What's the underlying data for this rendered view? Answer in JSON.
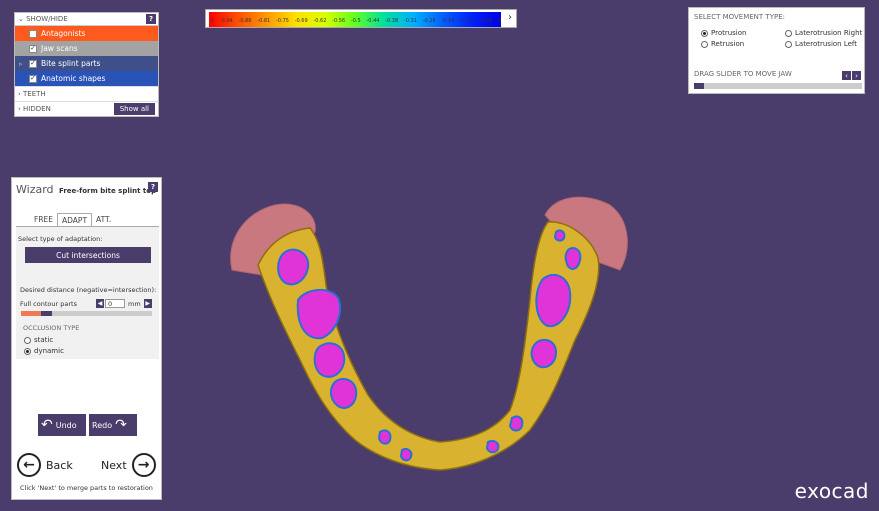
{
  "show_hide": {
    "title": "SHOW/HIDE",
    "help": "?",
    "items": [
      {
        "label": "Antagonists",
        "checked": false,
        "color": "#ff5a1e"
      },
      {
        "label": "Jaw scans",
        "checked": true,
        "color": "#a3a3a3"
      },
      {
        "label": "Bite splint parts",
        "checked": true,
        "color": "#3e4f8a"
      },
      {
        "label": "Anatomic shapes",
        "checked": true,
        "color": "#2a53b8"
      }
    ],
    "teeth_label": "TEETH",
    "hidden_label": "HIDDEN",
    "show_all_label": "Show all"
  },
  "color_scale": {
    "ticks": [
      "-1",
      "-0.94",
      "-0.88",
      "-0.81",
      "-0.75",
      "-0.69",
      "-0.62",
      "-0.56",
      "-0.5",
      "-0.44",
      "-0.38",
      "-0.31",
      "-0.25",
      "-0.19",
      "-0.12",
      "-0.06",
      "0"
    ],
    "arrow": "›"
  },
  "movement": {
    "title": "SELECT MOVEMENT TYPE:",
    "options": [
      {
        "label": "Protrusion",
        "selected": true
      },
      {
        "label": "Retrusion",
        "selected": false
      },
      {
        "label": "Laterotrusion Right",
        "selected": false
      },
      {
        "label": "Laterotrusion Left",
        "selected": false
      }
    ],
    "slider_label": "DRAG SLIDER TO MOVE JAW",
    "slider_value": 0.06
  },
  "wizard": {
    "title": "Wizard",
    "subtitle": "Free-form bite splint top",
    "help": "?",
    "tabs": [
      "FREE",
      "ADAPT",
      "ATT."
    ],
    "active_tab": "ADAPT",
    "adaptation_label": "Select type of adaptation:",
    "cut_button": "Cut intersections",
    "distance_label": "Desired distance (negative=intersection):",
    "full_contour_label": "Full contour parts",
    "distance_value": "0",
    "distance_unit": "mm",
    "occlusion_label": "OCCLUSION TYPE",
    "occlusion_options": [
      {
        "label": "static",
        "selected": false
      },
      {
        "label": "dynamic",
        "selected": true
      }
    ],
    "undo_label": "Undo",
    "redo_label": "Redo",
    "back_label": "Back",
    "next_label": "Next",
    "hint": "Click 'Next' to merge parts to restoration"
  },
  "brand": "exocad"
}
